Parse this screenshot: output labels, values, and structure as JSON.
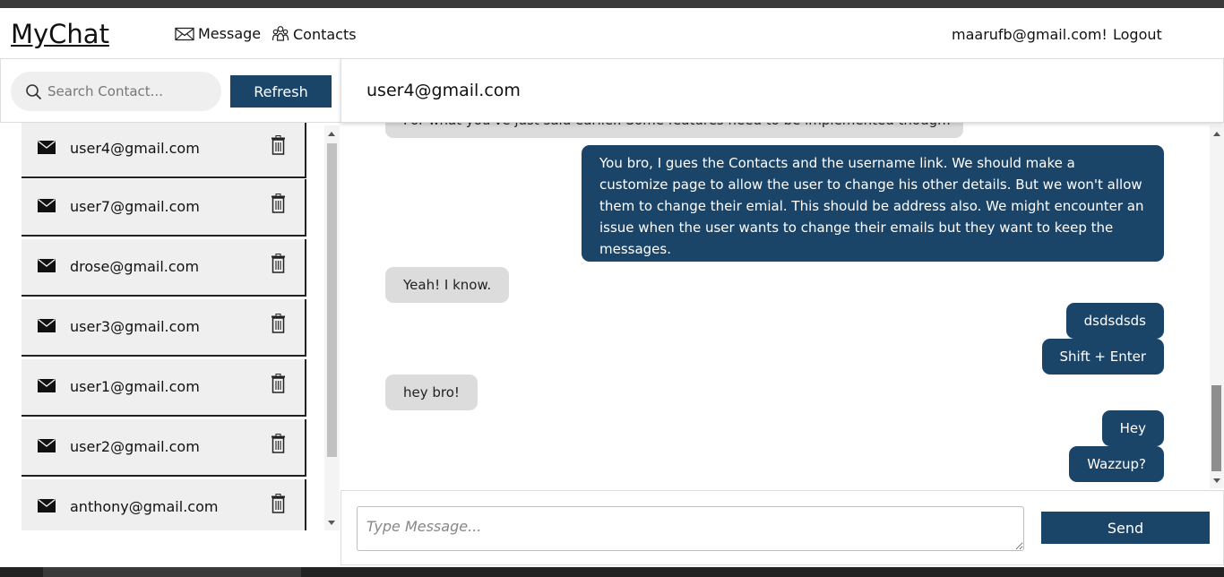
{
  "navbar": {
    "brand": "MyChat",
    "message_label": "Message",
    "contacts_label": "Contacts",
    "user_email": "maarufb@gmail.com!",
    "logout_label": "Logout"
  },
  "sidebar": {
    "search_placeholder": "Search Contact...",
    "refresh_label": "Refresh",
    "contacts": [
      {
        "email": "user4@gmail.com"
      },
      {
        "email": "user7@gmail.com"
      },
      {
        "email": "drose@gmail.com"
      },
      {
        "email": "user3@gmail.com"
      },
      {
        "email": "user1@gmail.com"
      },
      {
        "email": "user2@gmail.com"
      },
      {
        "email": "anthony@gmail.com"
      }
    ]
  },
  "chat": {
    "title": "user4@gmail.com",
    "messages": [
      {
        "direction": "in",
        "text": "For what you've just said earlier. Some features need to be implemented though!"
      },
      {
        "direction": "out",
        "text": "You bro, I gues the Contacts and the username link. We should make a customize page to allow the user to change his other details. But we won't allow them to change their emial. This should be address also. We might encounter an issue when the user wants to change their emails but they want to keep the messages."
      },
      {
        "direction": "in",
        "text": "Yeah! I know."
      },
      {
        "direction": "out",
        "text": "dsdsdsds"
      },
      {
        "direction": "out",
        "text": "Shift + Enter"
      },
      {
        "direction": "in",
        "text": "hey bro!"
      },
      {
        "direction": "out",
        "text": "Hey"
      },
      {
        "direction": "out",
        "text": "Wazzup?"
      }
    ],
    "input_placeholder": "Type Message...",
    "send_label": "Send"
  },
  "colors": {
    "accent": "#1b4469",
    "incoming_bubble": "#dcdcdc"
  },
  "icons": {
    "message": "envelope-icon",
    "contacts": "people-icon",
    "search": "search-icon",
    "contact_mail": "mail-icon",
    "delete": "trash-icon"
  }
}
